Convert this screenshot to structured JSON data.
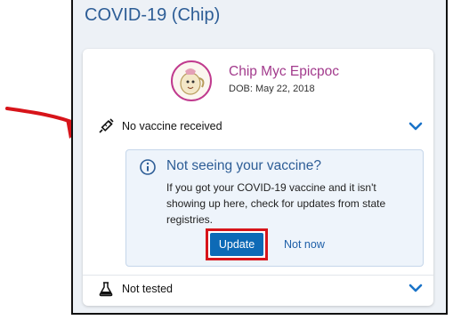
{
  "header": {
    "title": "COVID-19 (Chip)"
  },
  "patient": {
    "name": "Chip Myc Epicpoc",
    "dob": "DOB: May 22, 2018"
  },
  "vaccine": {
    "status": "No vaccine received"
  },
  "alert": {
    "title": "Not seeing your vaccine?",
    "body": "If you got your COVID-19 vaccine and it isn't showing up here, check for updates from state registries.",
    "update_label": "Update",
    "dismiss_label": "Not now"
  },
  "testing": {
    "status": "Not tested"
  },
  "colors": {
    "title_blue": "#2d5d96",
    "accent_magenta": "#a23a8c",
    "button_blue": "#0d6ab6",
    "highlight_red": "#d7141a"
  },
  "icons": [
    "red-arrow-icon",
    "syringe-icon",
    "info-icon",
    "flask-icon",
    "chevron-down-icon"
  ]
}
